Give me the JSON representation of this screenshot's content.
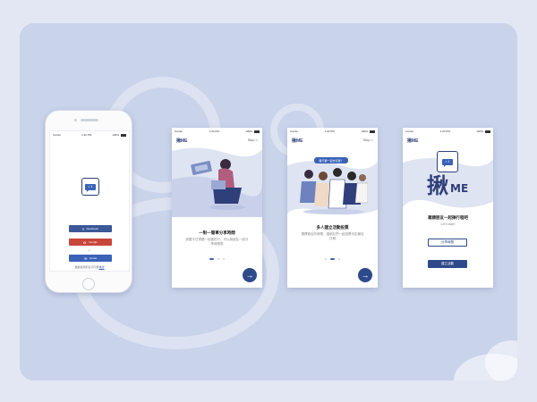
{
  "status": {
    "carrier": "Carrier",
    "time": "1:20 PM",
    "battery": "100%"
  },
  "login": {
    "facebook_label": "Facebook",
    "google_label": "Google",
    "or_label": "or",
    "email_label": "Email",
    "terms_text": "繼續使用即表示同意",
    "terms_link": "條款",
    "facebook_color": "#3b5998",
    "google_color": "#c8463a",
    "email_color": "#3a63b8"
  },
  "app": {
    "mark": "揪ME",
    "skip": "Skip >",
    "logo_glyph": "揪",
    "logo_me": "ME",
    "bubble_text": "• 1"
  },
  "onboard1": {
    "caption": "一對一簡單分享時間",
    "desc": "設置平日想要一起做的行，可以與朋友一起分享時間表"
  },
  "onboard2": {
    "tooltip": "要不要一起去玩耍？",
    "caption": "多人建立活動投票",
    "desc": "選擇適合的時間，讓朋友們一起投票決定最佳日期"
  },
  "onboard3": {
    "tagline": "邀請朋友一起揪行程吧",
    "lets_start": "Let's start!",
    "share_label": "分享時間",
    "create_label": "建立活動"
  },
  "colors": {
    "accent": "#2e4a8a",
    "brand": "#2e3f7a",
    "panel": "#c9d3ea"
  }
}
